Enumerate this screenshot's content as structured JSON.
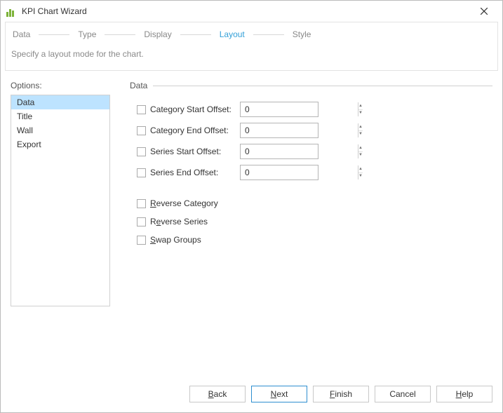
{
  "window": {
    "title": "KPI Chart Wizard"
  },
  "steps": {
    "items": [
      "Data",
      "Type",
      "Display",
      "Layout",
      "Style"
    ],
    "activeIndex": 3,
    "instruction": "Specify a layout mode for the chart."
  },
  "options": {
    "label": "Options:",
    "items": [
      "Data",
      "Title",
      "Wall",
      "Export"
    ],
    "selectedIndex": 0
  },
  "section": {
    "title": "Data",
    "offsets": [
      {
        "id": "cat-start",
        "label": "Category Start Offset:",
        "value": "0",
        "checked": false
      },
      {
        "id": "cat-end",
        "label": "Category End Offset:",
        "value": "0",
        "checked": false
      },
      {
        "id": "ser-start",
        "label": "Series Start Offset:",
        "value": "0",
        "checked": false
      },
      {
        "id": "ser-end",
        "label": "Series End Offset:",
        "value": "0",
        "checked": false
      }
    ],
    "toggles": [
      {
        "id": "rev-cat",
        "pre": "",
        "mn": "R",
        "post": "everse Category",
        "checked": false
      },
      {
        "id": "rev-ser",
        "pre": "R",
        "mn": "e",
        "post": "verse Series",
        "checked": false
      },
      {
        "id": "swap",
        "pre": "",
        "mn": "S",
        "post": "wap Groups",
        "checked": false
      }
    ]
  },
  "buttons": {
    "back": {
      "mn": "B",
      "rest": "ack"
    },
    "next": {
      "mn": "N",
      "rest": "ext"
    },
    "finish": {
      "mn": "F",
      "rest": "inish"
    },
    "cancel": {
      "label": "Cancel"
    },
    "help": {
      "mn": "H",
      "rest": "elp"
    }
  }
}
